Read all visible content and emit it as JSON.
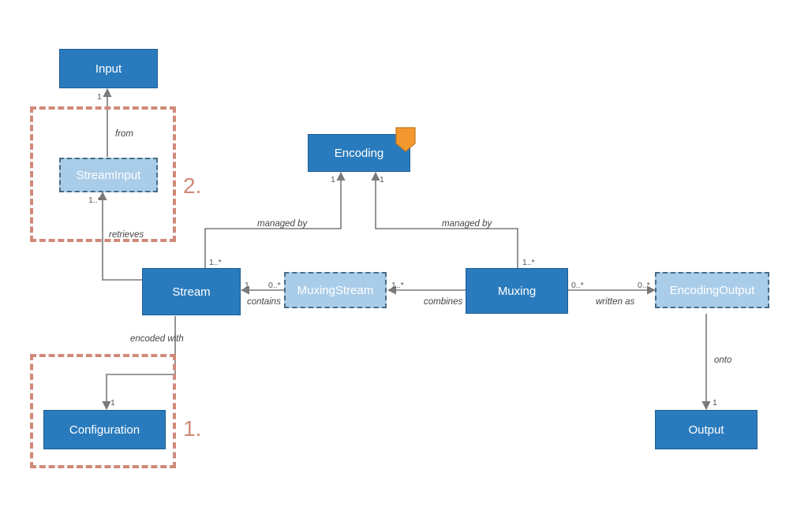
{
  "nodes": {
    "input": {
      "label": "Input"
    },
    "streamInput": {
      "label": "StreamInput"
    },
    "stream": {
      "label": "Stream"
    },
    "configuration": {
      "label": "Configuration"
    },
    "encoding": {
      "label": "Encoding"
    },
    "muxingStream": {
      "label": "MuxingStream"
    },
    "muxing": {
      "label": "Muxing"
    },
    "encodingOutput": {
      "label": "EncodingOutput"
    },
    "output": {
      "label": "Output"
    }
  },
  "edges": {
    "from": "from",
    "retrieves": "retrieves",
    "encodedWith": "encoded with",
    "managedBy1": "managed by",
    "managedBy2": "managed by",
    "contains": "contains",
    "combines": "combines",
    "writtenAs": "written as",
    "onto": "onto"
  },
  "mult": {
    "input_end": "1",
    "streamInput_end": "1..*",
    "stream_mb": "1..*",
    "enc_left": "1",
    "enc_right": "1",
    "muxing_mb": "1..*",
    "stream_contains": "1",
    "mstream_contains": "0..*",
    "mstream_combines": "1..*",
    "muxing_written": "0..*",
    "encOut_written": "0..*",
    "output_end": "1",
    "config_end": "1"
  },
  "annotations": {
    "one": "1.",
    "two": "2."
  }
}
